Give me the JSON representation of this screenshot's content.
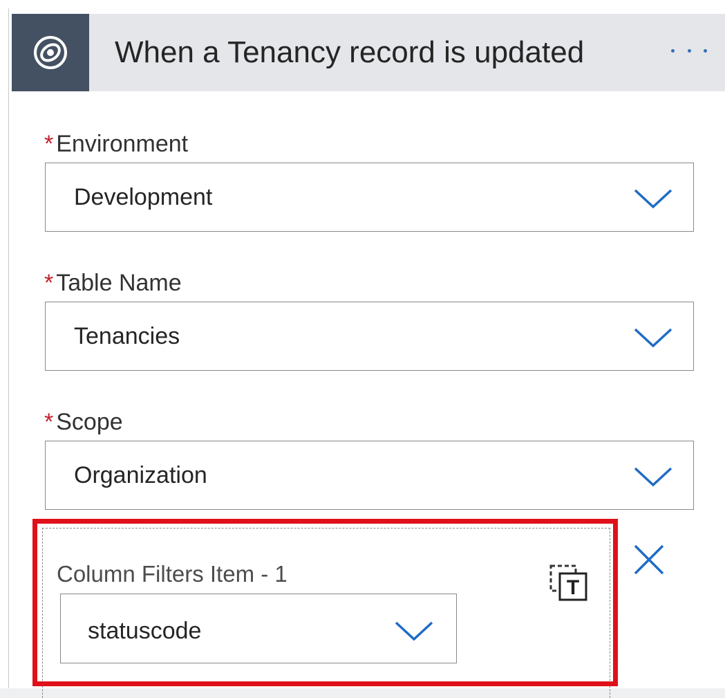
{
  "trigger": {
    "title": "When a Tenancy record is updated",
    "brand_color": "#445162",
    "icon": "dataverse-logo-icon",
    "more_icon": "more-options-icon"
  },
  "fields": {
    "environment": {
      "required_mark": "*",
      "label": "Environment",
      "value": "Development"
    },
    "table_name": {
      "required_mark": "*",
      "label": "Table Name",
      "value": "Tenancies"
    },
    "scope": {
      "required_mark": "*",
      "label": "Scope",
      "value": "Organization"
    }
  },
  "column_filter": {
    "label": "Column Filters Item - 1",
    "value": "statuscode",
    "highlight_color": "#e0101a",
    "text_mode_icon": "switch-to-text-mode-icon",
    "remove_icon": "close-icon"
  }
}
